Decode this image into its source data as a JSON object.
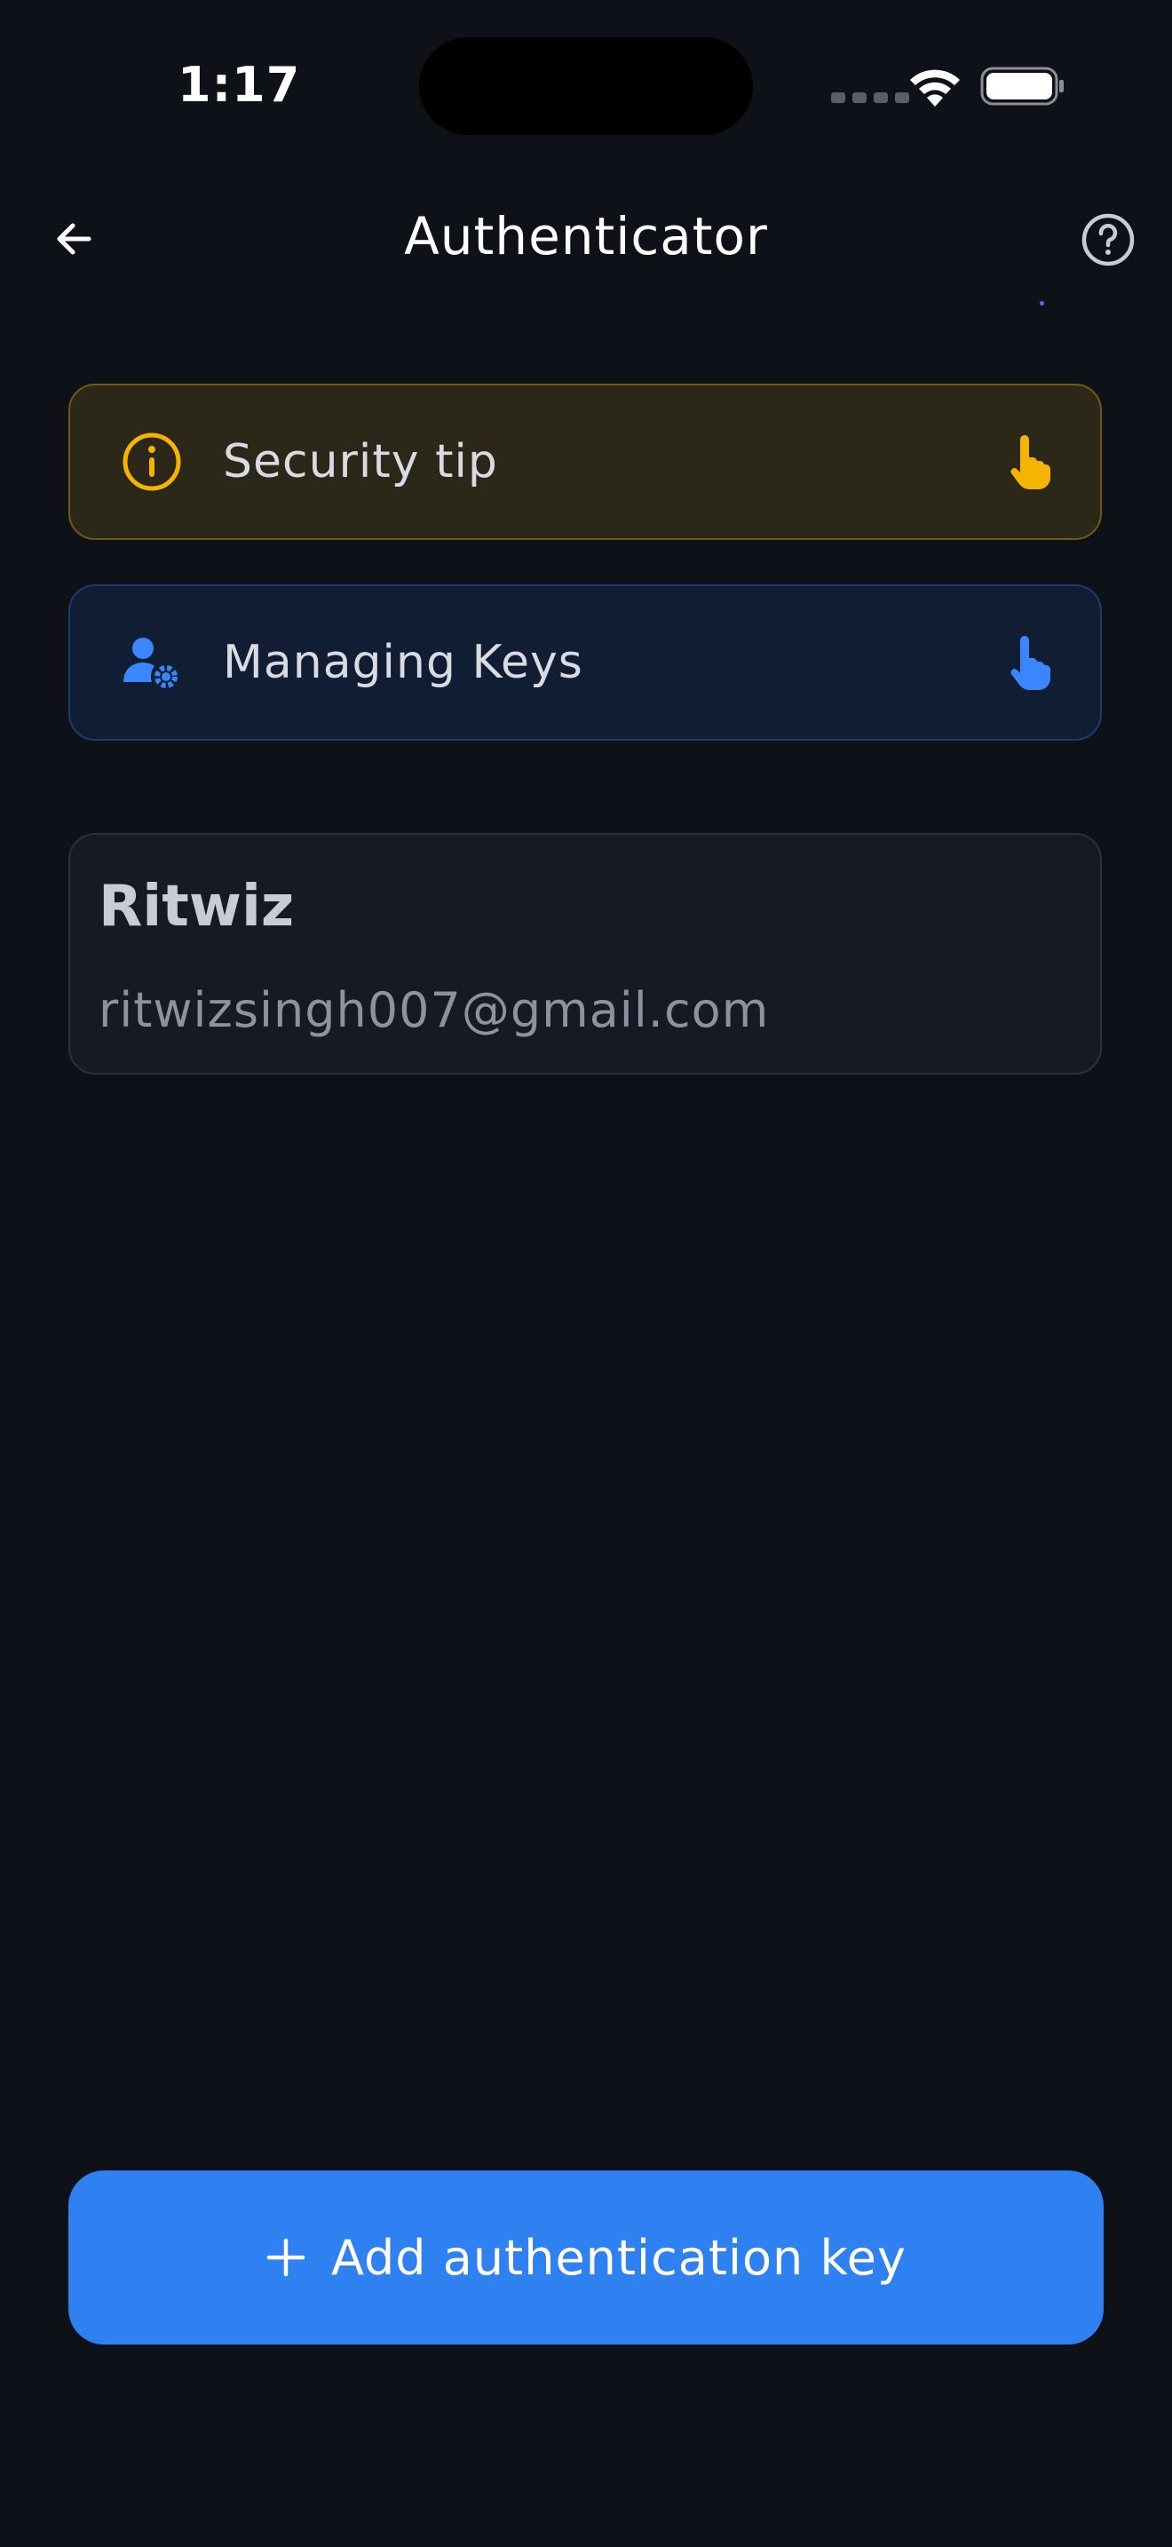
{
  "status_bar": {
    "time": "1:17"
  },
  "header": {
    "title": "Authenticator",
    "back_icon": "arrow-left-icon",
    "help_icon": "question-circle-icon"
  },
  "tips": [
    {
      "label": "Security tip",
      "icon": "info-circle-icon",
      "action_icon": "tap-hand-icon",
      "accent": "#f5b400"
    },
    {
      "label": "Managing Keys",
      "icon": "user-gear-icon",
      "action_icon": "tap-hand-icon",
      "accent": "#3a86ff"
    }
  ],
  "account": {
    "name": "Ritwiz",
    "email": "ritwizsingh007@gmail.com"
  },
  "primary_action": {
    "label": "Add authentication key",
    "icon": "plus-icon"
  },
  "colors": {
    "background": "#0e1118",
    "primary": "#2f80f0",
    "security_accent": "#f5b400",
    "keys_accent": "#3a86ff"
  }
}
